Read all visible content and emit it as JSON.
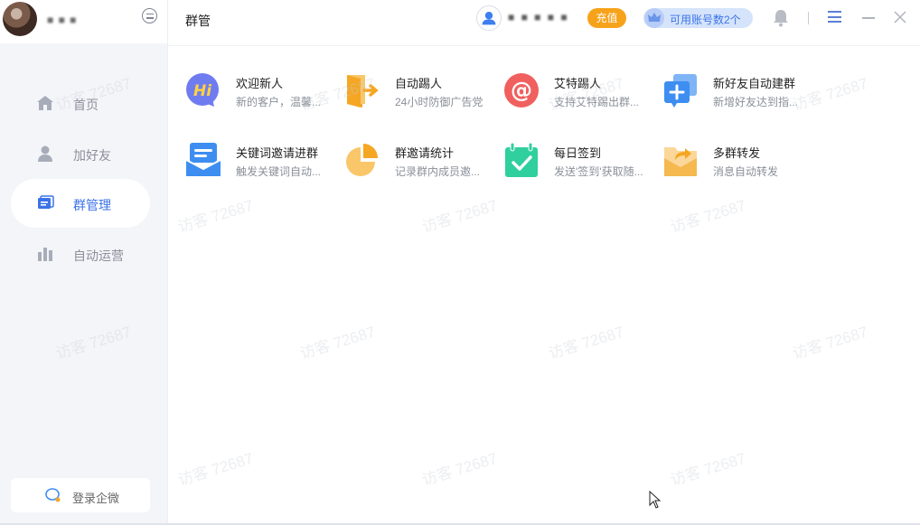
{
  "sidebar": {
    "username": "■ ■ ■",
    "items": [
      {
        "label": "首页",
        "icon": "home-icon",
        "active": false
      },
      {
        "label": "加好友",
        "icon": "user-icon",
        "active": false
      },
      {
        "label": "群管理",
        "icon": "group-manage-icon",
        "active": true
      },
      {
        "label": "自动运营",
        "icon": "bar-chart-icon",
        "active": false
      }
    ],
    "login_label": "登录企微"
  },
  "header": {
    "title": "群管",
    "user_name": "■ ■ ■ ■ ■",
    "recharge_label": "充值",
    "accounts_label": "可用账号数2个"
  },
  "tiles": [
    {
      "name": "欢迎新人",
      "desc": "新的客户，温馨...",
      "icon": "hi-icon",
      "color": "#6f7cf0"
    },
    {
      "name": "自动踢人",
      "desc": "24小时防御广告党",
      "icon": "exit-door-icon",
      "color": "#f5a623"
    },
    {
      "name": "艾特踢人",
      "desc": "支持艾特踢出群...",
      "icon": "at-icon",
      "color": "#f0605e"
    },
    {
      "name": "新好友自动建群",
      "desc": "新增好友达到指...",
      "icon": "new-group-icon",
      "color": "#3d8ef0"
    },
    {
      "name": "关键词邀请进群",
      "desc": "触发关键词自动...",
      "icon": "keyword-invite-icon",
      "color": "#3d8ef0"
    },
    {
      "name": "群邀请统计",
      "desc": "记录群内成员邀...",
      "icon": "pie-chart-icon",
      "color": "#f5a623"
    },
    {
      "name": "每日签到",
      "desc": "发送'签到'获取随...",
      "icon": "calendar-check-icon",
      "color": "#2fcf9e"
    },
    {
      "name": "多群转发",
      "desc": "消息自动转发",
      "icon": "forward-folder-icon",
      "color": "#f5b950"
    }
  ],
  "watermark": "访客 72687"
}
